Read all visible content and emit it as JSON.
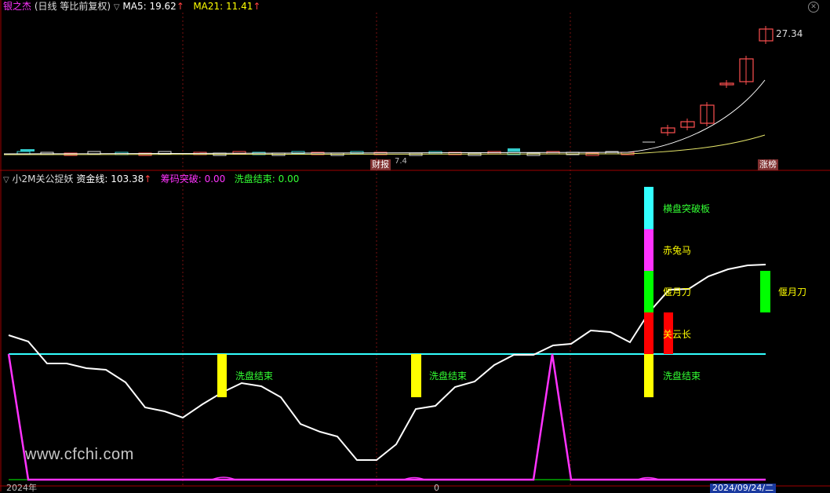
{
  "top_panel": {
    "title": "银之杰",
    "mode": "(日线 等比前复权)",
    "ma5_label": "MA5: 19.62",
    "ma21_label": "MA21: 11.41",
    "price_tag": "27.34",
    "caibao_tag": "财报",
    "zhangting_tag": "涨榜",
    "small_tag": "7.4"
  },
  "indicator_panel": {
    "name": "小2M关公捉妖",
    "zijinxian": "资金线: 103.38",
    "choumatupo": "筹码突破: 0.00",
    "xipanjieshu": "洗盘结束: 0.00",
    "annotations": {
      "hengpan": "横盘突破板",
      "chituma": "赤兔马",
      "yanyuedao1": "偃月刀",
      "guanyunchang": "关云长",
      "xipan1": "洗盘结束",
      "xipan2": "洗盘结束",
      "xipan3": "洗盘结束",
      "yanyuedao2": "偃月刀"
    }
  },
  "bottom_axis": {
    "year_label": "2024年",
    "zero_label": "0",
    "date_label": "2024/09/24/二"
  },
  "watermark": "www.cfchi.com",
  "colors": {
    "magenta": "#ff33ff",
    "cyan": "#33ffff",
    "yellow": "#ffff00",
    "green": "#00ff00",
    "red": "#ff0000",
    "white": "#ffffff",
    "candle_up": "#ff5050"
  },
  "chart_data": [
    {
      "type": "candlestick",
      "title": "银之杰",
      "series": [
        {
          "name": "MA5",
          "last_value": 19.62
        },
        {
          "name": "MA21",
          "last_value": 11.41
        }
      ],
      "max_marker": 27.34
    },
    {
      "type": "line",
      "title": "小2M关公捉妖",
      "series": [
        {
          "name": "资金线",
          "last_value": 103.38
        },
        {
          "name": "筹码突破",
          "last_value": 0.0
        },
        {
          "name": "洗盘结束",
          "last_value": 0.0
        }
      ]
    }
  ]
}
